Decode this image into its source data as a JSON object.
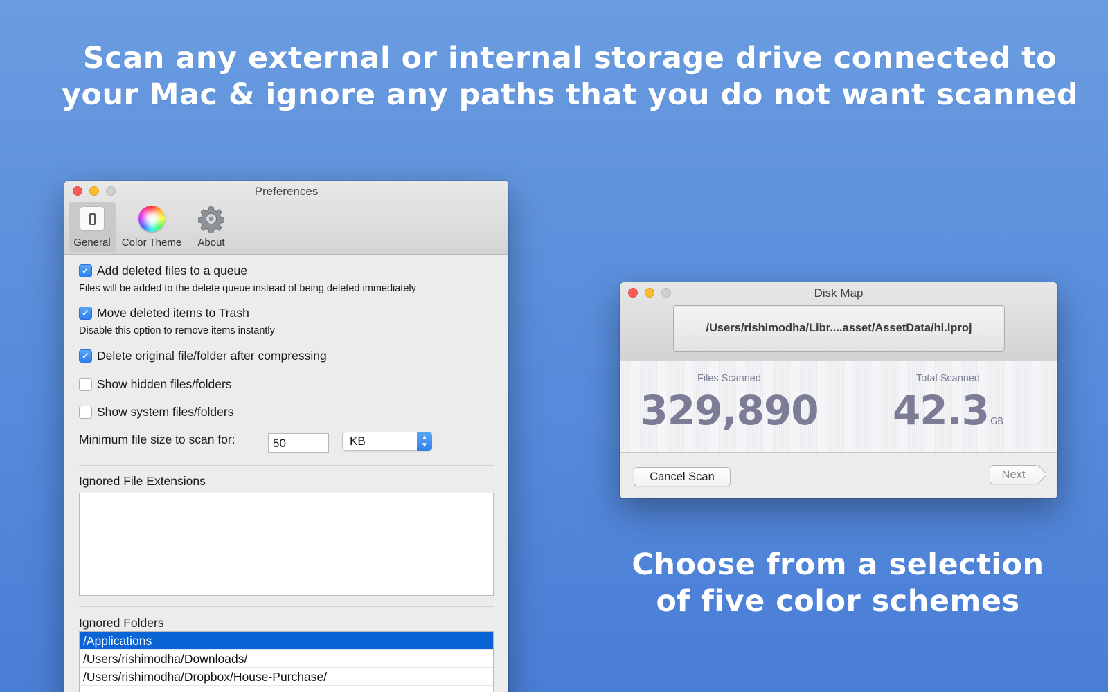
{
  "headline": {
    "line1": "Scan any external or internal storage drive connected to",
    "line2": "your Mac & ignore any paths that you do not want scanned"
  },
  "subline": {
    "line1": "Choose from a selection",
    "line2": "of five color schemes"
  },
  "preferences": {
    "title": "Preferences",
    "tabs": [
      {
        "label": "General",
        "icon": "switch-icon",
        "active": true
      },
      {
        "label": "Color Theme",
        "icon": "color-wheel-icon"
      },
      {
        "label": "About",
        "icon": "gear-icon"
      }
    ],
    "options": [
      {
        "label": "Add deleted files to a queue",
        "checked": true,
        "hint": "Files will be added to the delete queue instead of being deleted immediately"
      },
      {
        "label": "Move deleted items to Trash",
        "checked": true,
        "hint": "Disable this option to remove items instantly"
      },
      {
        "label": "Delete original file/folder after compressing",
        "checked": true
      },
      {
        "label": "Show hidden files/folders",
        "checked": false
      },
      {
        "label": "Show system files/folders",
        "checked": false
      }
    ],
    "checkmark": "✓",
    "min_size": {
      "label": "Minimum file size to scan for:",
      "value": "50",
      "unit": "KB"
    },
    "ignored_extensions": {
      "label": "Ignored File Extensions"
    },
    "ignored_folders": {
      "label": "Ignored Folders",
      "items": [
        "/Applications",
        "/Users/rishimodha/Downloads/",
        "/Users/rishimodha/Dropbox/House-Purchase/"
      ]
    }
  },
  "diskmap": {
    "title": "Disk Map",
    "path": "/Users/rishimodha/Libr....asset/AssetData/hi.lproj",
    "files_scanned": {
      "label": "Files Scanned",
      "value": "329,890"
    },
    "total_scanned": {
      "label": "Total Scanned",
      "value": "42.3",
      "unit": "GB"
    },
    "cancel_label": "Cancel Scan",
    "next_label": "Next"
  },
  "colors": {
    "accent": "#2f80ed",
    "selection": "#0a64d6",
    "background_top": "#6a9ce0",
    "background_bottom": "#4a7ed6",
    "stat_text": "#7c7c96"
  }
}
